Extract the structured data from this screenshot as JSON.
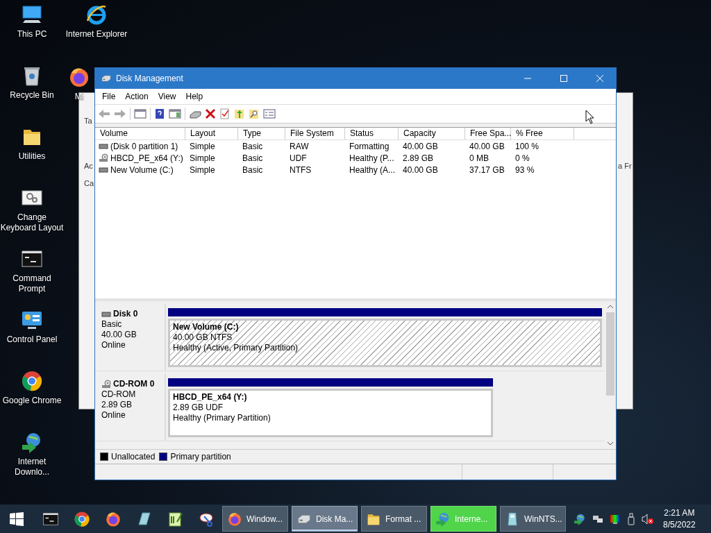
{
  "desktop_icons": [
    {
      "label": "This PC",
      "kind": "pc"
    },
    {
      "label": "Recycle Bin",
      "kind": "bin"
    },
    {
      "label": "Utilities",
      "kind": "folder"
    },
    {
      "label": "Change Keyboard Layout",
      "kind": "keyboard"
    },
    {
      "label": "Command Prompt",
      "kind": "cmd"
    },
    {
      "label": "Control Panel",
      "kind": "control"
    },
    {
      "label": "Google Chrome",
      "kind": "chrome"
    },
    {
      "label": "Internet Downlo...",
      "kind": "idm"
    }
  ],
  "desktop_icons_column_2": [
    {
      "label": "Internet Explorer",
      "kind": "ie"
    },
    {
      "label": "Mi",
      "kind": "firefox"
    }
  ],
  "background_window": {
    "texts": [
      "Ta",
      "Ac",
      "Ca",
      "a Fr"
    ]
  },
  "window": {
    "title": "Disk Management",
    "menu": [
      "File",
      "Action",
      "View",
      "Help"
    ],
    "volume_list": {
      "columns": [
        "Volume",
        "Layout",
        "Type",
        "File System",
        "Status",
        "Capacity",
        "Free Spa...",
        "% Free"
      ],
      "rows": [
        {
          "kind": "hdd",
          "cells": [
            "(Disk 0 partition 1)",
            "Simple",
            "Basic",
            "RAW",
            "Formatting",
            "40.00 GB",
            "40.00 GB",
            "100 %"
          ]
        },
        {
          "kind": "cd",
          "cells": [
            "HBCD_PE_x64 (Y:)",
            "Simple",
            "Basic",
            "UDF",
            "Healthy (P...",
            "2.89 GB",
            "0 MB",
            "0 %"
          ]
        },
        {
          "kind": "hdd",
          "cells": [
            "New Volume (C:)",
            "Simple",
            "Basic",
            "NTFS",
            "Healthy (A...",
            "40.00 GB",
            "37.17 GB",
            "93 %"
          ]
        }
      ]
    },
    "disks": [
      {
        "kind": "hdd",
        "name": "Disk 0",
        "type": "Basic",
        "size": "40.00 GB",
        "status": "Online",
        "partition": {
          "name": "New Volume  (C:)",
          "detail": "40.00 GB NTFS",
          "status": "Healthy (Active, Primary Partition)",
          "selected": true
        }
      },
      {
        "kind": "cd",
        "name": "CD-ROM 0",
        "type": "CD-ROM",
        "size": "2.89 GB",
        "status": "Online",
        "partition": {
          "name": "HBCD_PE_x64  (Y:)",
          "detail": "2.89 GB UDF",
          "status": "Healthy (Primary Partition)",
          "selected": false
        }
      }
    ],
    "legend": [
      {
        "label": "Unallocated",
        "color": "#000000"
      },
      {
        "label": "Primary partition",
        "color": "#000080"
      }
    ]
  },
  "taskbar": {
    "tasks": [
      {
        "label": "Window...",
        "kind": "firefox",
        "selected": false,
        "highlighted": false
      },
      {
        "label": "Disk Ma...",
        "kind": "disk",
        "selected": true,
        "highlighted": false
      },
      {
        "label": "Format ...",
        "kind": "folder",
        "selected": false,
        "highlighted": false
      },
      {
        "label": "Interne...",
        "kind": "idm",
        "selected": false,
        "highlighted": true
      },
      {
        "label": "WinNTS...",
        "kind": "setup",
        "selected": false,
        "highlighted": false
      }
    ],
    "clock": {
      "time": "2:21 AM",
      "date": "8/5/2022"
    }
  }
}
